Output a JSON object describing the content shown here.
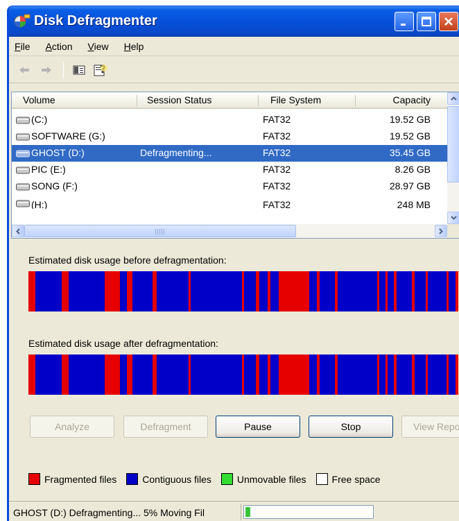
{
  "window": {
    "title": "Disk Defragmenter",
    "controls": {
      "minimize": "minimize-icon",
      "maximize": "maximize-icon",
      "close": "close-icon"
    }
  },
  "menu": [
    {
      "label": "File",
      "accel": "F",
      "rest": "ile"
    },
    {
      "label": "Action",
      "accel": "A",
      "rest": "ction"
    },
    {
      "label": "View",
      "accel": "V",
      "rest": "iew"
    },
    {
      "label": "Help",
      "accel": "H",
      "rest": "elp"
    }
  ],
  "toolbar": {
    "items": [
      "back-arrow-icon",
      "forward-arrow-icon",
      "show-hide-console-tree-icon",
      "help-icon"
    ]
  },
  "volumes": {
    "columns": [
      "Volume",
      "Session Status",
      "File System",
      "Capacity"
    ],
    "rows": [
      {
        "volume": "(C:)",
        "status": "",
        "fs": "FAT32",
        "capacity": "19.52 GB"
      },
      {
        "volume": "SOFTWARE (G:)",
        "status": "",
        "fs": "FAT32",
        "capacity": "19.52 GB"
      },
      {
        "volume": "GHOST (D:)",
        "status": "Defragmenting...",
        "fs": "FAT32",
        "capacity": "35.45 GB"
      },
      {
        "volume": "PIC (E:)",
        "status": "",
        "fs": "FAT32",
        "capacity": "8.26 GB"
      },
      {
        "volume": "SONG (F:)",
        "status": "",
        "fs": "FAT32",
        "capacity": "28.97 GB"
      },
      {
        "volume": "(H:)",
        "status": "",
        "fs": "FAT32",
        "capacity": "248 MB"
      }
    ],
    "selected_index": 2
  },
  "usage": {
    "before_label": "Estimated disk usage before defragmentation:",
    "after_label": "Estimated disk usage after defragmentation:",
    "fragmented_segments_before": [
      [
        0,
        10
      ],
      [
        48,
        58
      ],
      [
        110,
        132
      ],
      [
        142,
        150
      ],
      [
        179,
        185
      ],
      [
        231,
        234
      ],
      [
        308,
        311
      ],
      [
        328,
        333
      ],
      [
        345,
        349
      ],
      [
        361,
        405
      ],
      [
        416,
        420
      ],
      [
        442,
        446
      ],
      [
        503,
        506
      ],
      [
        515,
        518
      ],
      [
        527,
        531
      ],
      [
        553,
        557
      ],
      [
        573,
        576
      ],
      [
        603,
        606
      ],
      [
        616,
        620
      ]
    ],
    "fragmented_segments_after": [
      [
        0,
        10
      ],
      [
        48,
        58
      ],
      [
        110,
        132
      ],
      [
        142,
        150
      ],
      [
        179,
        185
      ],
      [
        231,
        234
      ],
      [
        308,
        311
      ],
      [
        328,
        333
      ],
      [
        345,
        349
      ],
      [
        361,
        405
      ],
      [
        416,
        420
      ],
      [
        442,
        446
      ],
      [
        503,
        506
      ],
      [
        515,
        518
      ],
      [
        527,
        531
      ],
      [
        553,
        557
      ],
      [
        573,
        576
      ],
      [
        603,
        606
      ],
      [
        616,
        620
      ]
    ]
  },
  "buttons": {
    "analyze": "Analyze",
    "defragment": "Defragment",
    "pause": "Pause",
    "stop": "Stop",
    "view_report": "View Repo"
  },
  "legend": [
    {
      "label": "Fragmented files",
      "color": "#e60000"
    },
    {
      "label": "Contiguous files",
      "color": "#0000c8"
    },
    {
      "label": "Unmovable files",
      "color": "#33dd33"
    },
    {
      "label": "Free space",
      "color": "#ffffff"
    }
  ],
  "status": {
    "text": "GHOST (D:) Defragmenting... 5%  Moving Fil",
    "progress_fraction": 0.05
  },
  "colors": {
    "fragmented": "#e60000",
    "contiguous": "#0000c8",
    "selection": "#316ac5",
    "titlebar": "#0551da"
  }
}
